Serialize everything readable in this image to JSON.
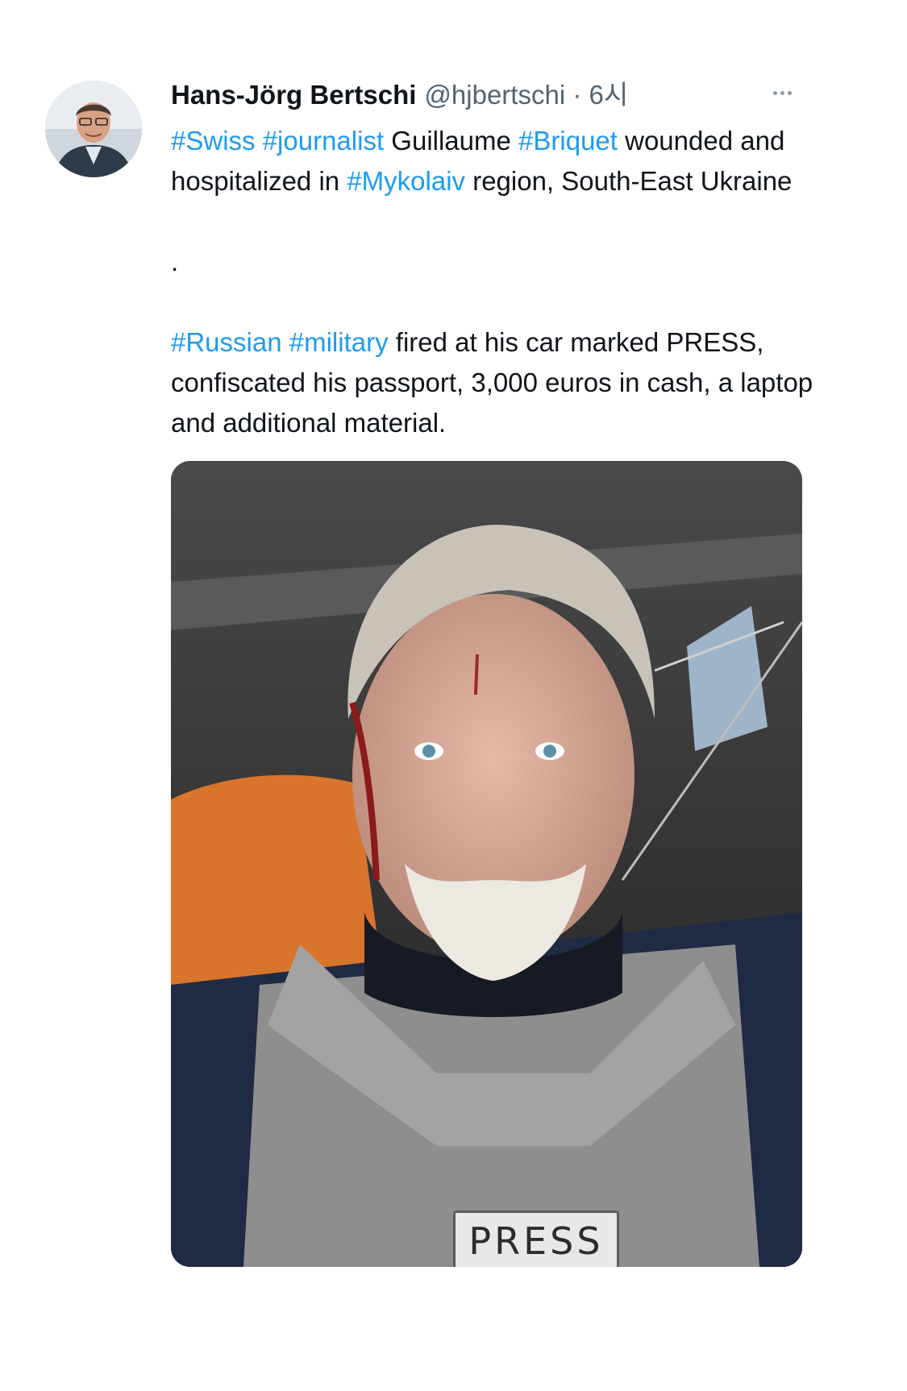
{
  "author": {
    "display_name": "Hans-Jörg Bertschi",
    "handle": "@hjbertschi",
    "separator": "·",
    "time": "6시"
  },
  "tweet": {
    "para1": {
      "hashtag_swiss": "#Swiss",
      "hashtag_journalist": "#journalist",
      "text_guillaume": " Guillaume ",
      "hashtag_briquet": "#Briquet",
      "text_wounded": " wounded and hospitalized in ",
      "hashtag_mykolaiv": "#Mykolaiv",
      "text_region": " region, South-East Ukraine ",
      "end": "."
    },
    "para2": {
      "hashtag_russian": "#Russian",
      "hashtag_military": "#military",
      "text_rest": " fired at his car marked PRESS, confiscated his passport, 3,000 euros in cash, a laptop and additional material."
    }
  },
  "media": {
    "patch_text": "PRESS"
  },
  "icons": {
    "more": "more-icon",
    "flag": "ukraine-flag-icon"
  },
  "colors": {
    "text": "#0f1419",
    "secondary": "#536471",
    "hashtag": "#1d9bf0"
  }
}
